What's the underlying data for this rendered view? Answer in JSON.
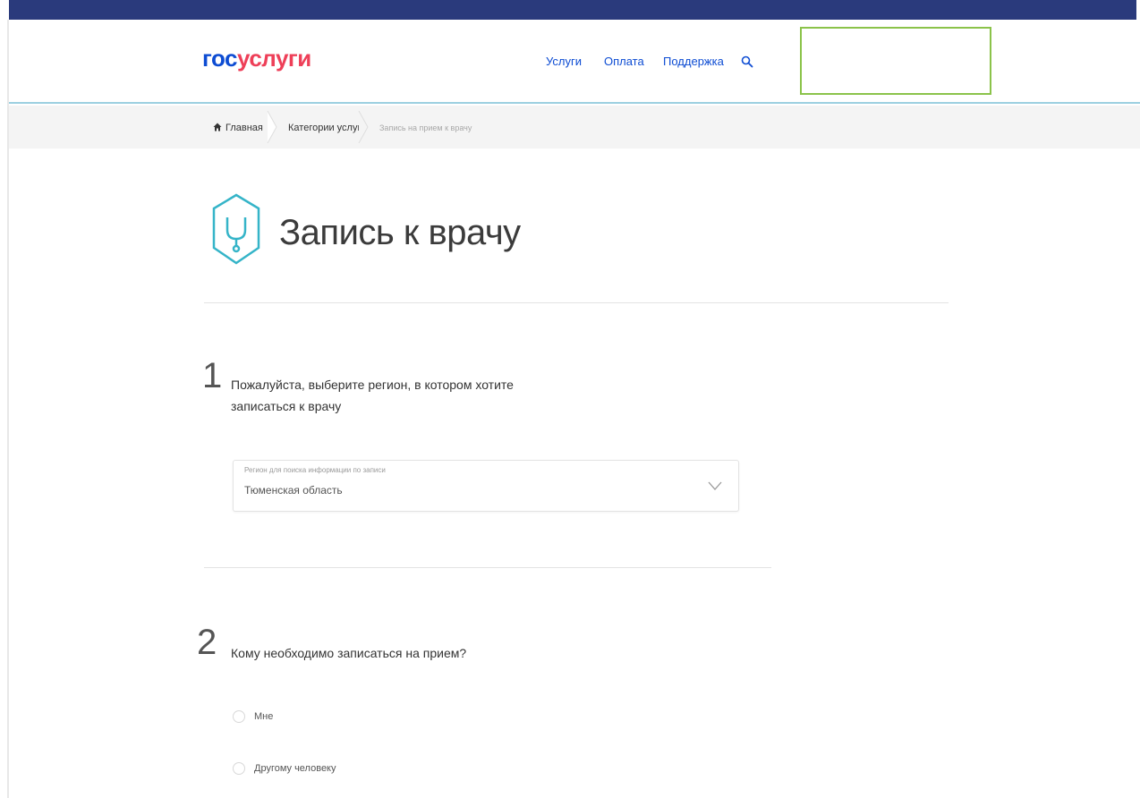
{
  "header": {
    "logo": {
      "part1": "гос",
      "part2": "услуги"
    },
    "nav": [
      "Услуги",
      "Оплата",
      "Поддержка"
    ],
    "icons": {
      "search": "search-icon"
    },
    "colors": {
      "logo_blue": "#0d4cd3",
      "logo_red": "#ee3f58",
      "top_bar": "#2a3a7c",
      "accent": "#2aa3c6"
    }
  },
  "breadcrumb": {
    "home": "Главная",
    "categories": "Категории услуг",
    "current": "Запись на прием к врачу"
  },
  "page": {
    "title": "Запись к врачу",
    "icon": "stethoscope-icon"
  },
  "step1": {
    "number": "1",
    "question": "Пожалуйста, выберите регион, в котором хотите записаться к врачу",
    "select": {
      "label": "Регион для поиска информации по записи",
      "value": "Тюменская область"
    }
  },
  "step2": {
    "number": "2",
    "question": "Кому необходимо записаться на прием?",
    "options": [
      "Мне",
      "Другому человеку"
    ]
  }
}
